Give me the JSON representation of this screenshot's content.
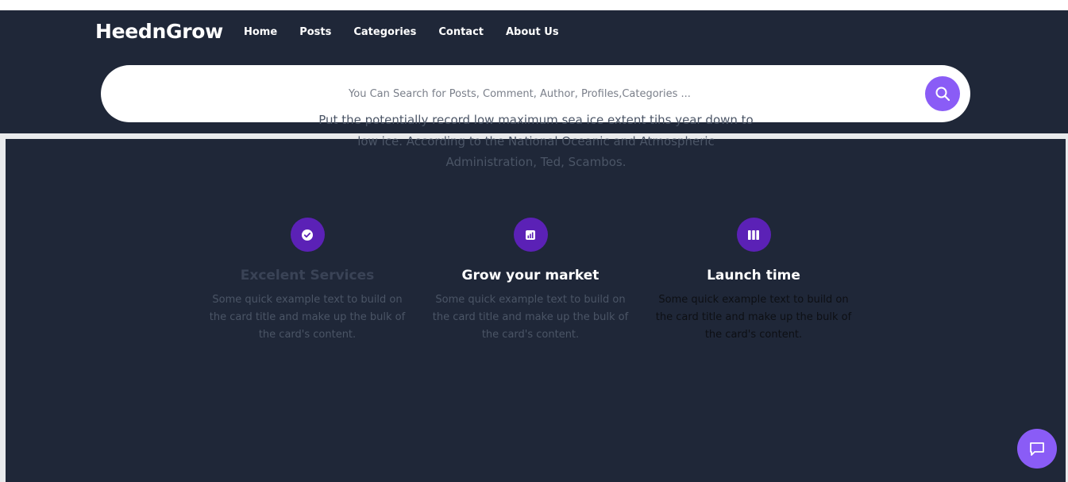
{
  "header": {
    "brand": "HeednGrow",
    "nav": [
      "Home",
      "Posts",
      "Categories",
      "Contact",
      "About Us"
    ]
  },
  "search": {
    "placeholder": "You Can Search for Posts, Comment, Author, Profiles,Categories ...",
    "icon": "search-icon"
  },
  "intro": {
    "text": "Put the potentially record low maximum sea ice extent tihs year down to low ice. According to the National Oceanic and Atmospheric Administration, Ted, Scambos."
  },
  "features": [
    {
      "icon": "check-circle-icon",
      "title": "Excelent Services",
      "description": "Some quick example text to build on the card title and make up the bulk of the card's content."
    },
    {
      "icon": "chart-icon",
      "title": "Grow your market",
      "description": "Some quick example text to build on the card title and make up the bulk of the card's content."
    },
    {
      "icon": "columns-icon",
      "title": "Launch time",
      "description": "Some quick example text to build on the card title and make up the bulk of the card's content."
    }
  ],
  "chat": {
    "icon": "chat-icon"
  },
  "colors": {
    "navy": "#1f2738",
    "accent": "#8a5cf6",
    "feature_icon_bg": "#5b21b6"
  }
}
